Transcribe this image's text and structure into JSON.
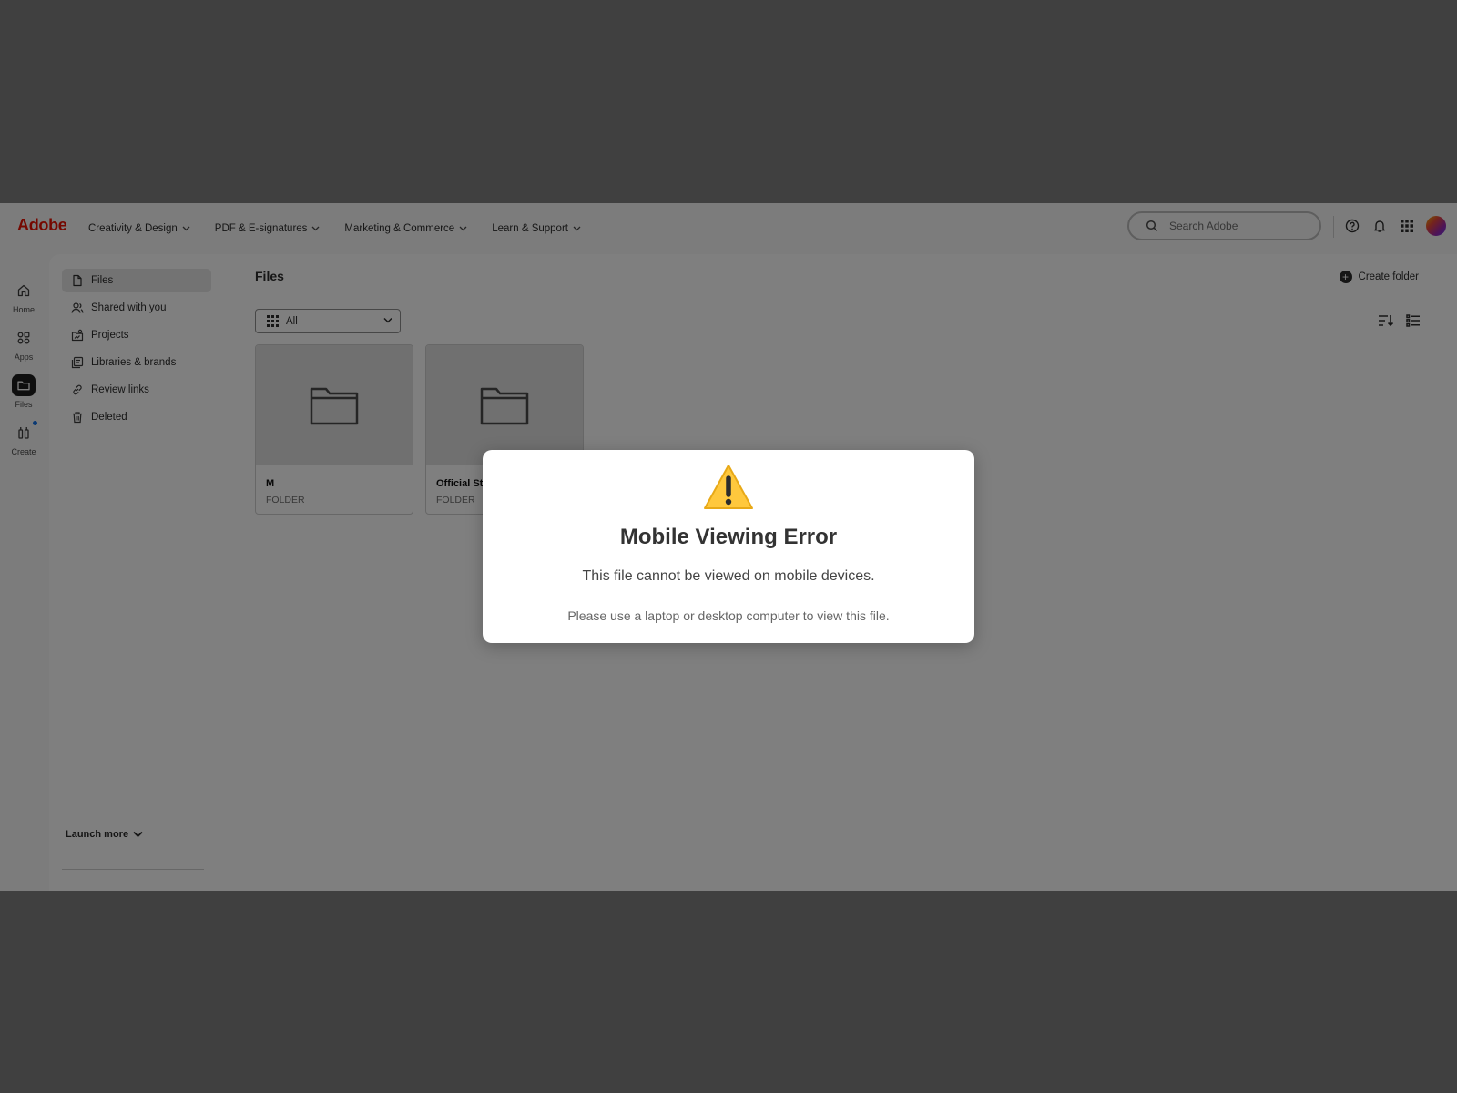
{
  "header": {
    "logo": "Adobe",
    "nav": [
      {
        "label": "Creativity & Design"
      },
      {
        "label": "PDF & E-signatures"
      },
      {
        "label": "Marketing & Commerce"
      },
      {
        "label": "Learn & Support"
      }
    ],
    "search_placeholder": "Search Adobe"
  },
  "rail": {
    "items": [
      {
        "label": "Home",
        "icon": "home-icon"
      },
      {
        "label": "Apps",
        "icon": "apps-icon"
      },
      {
        "label": "Files",
        "icon": "folder-icon",
        "active": true
      },
      {
        "label": "Create",
        "icon": "create-icon",
        "badge": true
      }
    ]
  },
  "sidebar": {
    "items": [
      {
        "label": "Files",
        "icon": "file-icon",
        "active": true
      },
      {
        "label": "Shared with you",
        "icon": "shared-icon"
      },
      {
        "label": "Projects",
        "icon": "projects-icon"
      },
      {
        "label": "Libraries & brands",
        "icon": "libraries-icon"
      },
      {
        "label": "Review links",
        "icon": "link-icon"
      },
      {
        "label": "Deleted",
        "icon": "trash-icon"
      }
    ],
    "launch_more": "Launch more"
  },
  "main": {
    "title": "Files",
    "create_folder": "Create folder",
    "filter_value": "All",
    "cards": [
      {
        "name": "M",
        "type": "FOLDER"
      },
      {
        "name": "Official Sta",
        "type": "FOLDER"
      }
    ]
  },
  "modal": {
    "icon": "⚠️",
    "title": "Mobile Viewing Error",
    "message": "This file cannot be viewed on mobile devices.",
    "submessage": "Please use a laptop or desktop computer to view this file."
  },
  "colors": {
    "brand": "#eb1000",
    "overlay": "rgba(0,0,0,0.5)",
    "accent_dot": "#1473e6"
  }
}
